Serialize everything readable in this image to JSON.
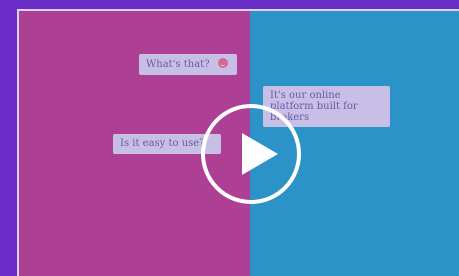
{
  "video": {
    "colors": {
      "left_panel": "#ad3f95",
      "right_panel": "#2b93c8",
      "background": "#6a2cc6"
    },
    "bubbles": {
      "question_1": "What's that?",
      "answer_1": "It's our online platform built for brokers",
      "question_2": "Is it easy to use?"
    },
    "play_icon": "play-icon",
    "emoji_icon": "smiley-emoji-icon"
  }
}
